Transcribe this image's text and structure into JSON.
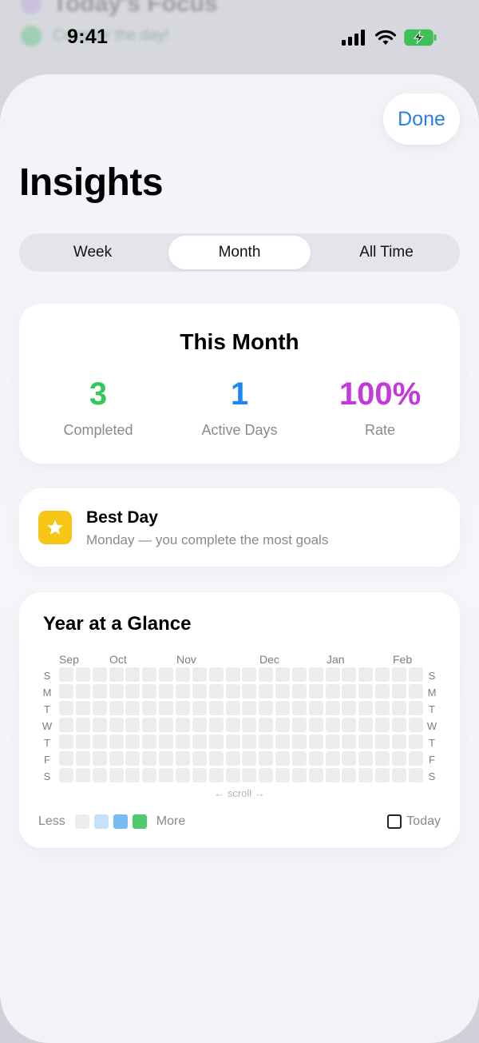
{
  "background_app": {
    "title": "Today's Focus",
    "subtitle": "Conquer the day!"
  },
  "status_bar": {
    "time": "9:41",
    "icons": [
      "signal-icon",
      "wifi-icon",
      "battery-charging-icon"
    ]
  },
  "header": {
    "done_label": "Done",
    "title": "Insights"
  },
  "tabs": [
    {
      "label": "Week",
      "active": false
    },
    {
      "label": "Month",
      "active": true
    },
    {
      "label": "All Time",
      "active": false
    }
  ],
  "summary": {
    "title": "This Month",
    "stats": [
      {
        "value": "3",
        "label": "Completed",
        "color": "#34c759"
      },
      {
        "value": "1",
        "label": "Active Days",
        "color": "#1c86f2"
      },
      {
        "value": "100%",
        "label": "Rate",
        "color": "#c23bd9"
      }
    ]
  },
  "best_day": {
    "icon": "star-icon",
    "title": "Best Day",
    "subtitle": "Monday — you complete the most goals"
  },
  "year": {
    "title": "Year at a Glance",
    "months": [
      "Sep",
      "Oct",
      "Nov",
      "Dec",
      "Jan",
      "Feb"
    ],
    "weekdays": [
      "S",
      "M",
      "T",
      "W",
      "T",
      "F",
      "S"
    ],
    "scroll_hint": "← scroll →",
    "legend_less": "Less",
    "legend_more": "More",
    "legend_colors": [
      "#ececef",
      "#c5e1fb",
      "#79bcf5",
      "#4fcb6e"
    ],
    "today_label": "Today"
  }
}
